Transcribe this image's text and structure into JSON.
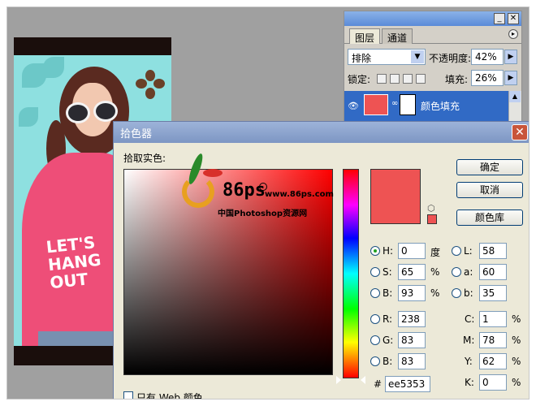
{
  "layers_panel": {
    "tabs": [
      "图层",
      "通道"
    ],
    "blend_mode": "排除",
    "opacity_label": "不透明度:",
    "opacity_value": "42%",
    "lock_label": "锁定:",
    "fill_label": "填充:",
    "fill_value": "26%",
    "layer_name": "颜色填充"
  },
  "picker": {
    "title": "拾色器",
    "pick_label": "拾取实色:",
    "buttons": {
      "ok": "确定",
      "cancel": "取消",
      "library": "颜色库"
    },
    "hsb": {
      "h_label": "H:",
      "h": "0",
      "h_unit": "度",
      "s_label": "S:",
      "s": "65",
      "s_unit": "%",
      "b_label": "B:",
      "b": "93",
      "b_unit": "%"
    },
    "rgb": {
      "r_label": "R:",
      "r": "238",
      "g_label": "G:",
      "g": "83",
      "b_label": "B:",
      "b": "83"
    },
    "lab": {
      "l_label": "L:",
      "l": "58",
      "a_label": "a:",
      "a": "60",
      "b_label": "b:",
      "b": "35"
    },
    "cmyk": {
      "c_label": "C:",
      "c": "1",
      "m_label": "M:",
      "m": "78",
      "y_label": "Y:",
      "y": "62",
      "k_label": "K:",
      "k": "0",
      "unit": "%"
    },
    "hex_label": "#",
    "hex": "ee5353",
    "web_only_label": "只有 Web 颜色",
    "current_color": "#ee5353"
  },
  "photo": {
    "shirt_text": [
      "LET'S",
      "HANG",
      "OUT"
    ]
  },
  "watermark": {
    "brand": "86ps",
    "url": "www.86ps.com",
    "chinese": "中国Photoshop资源网"
  }
}
